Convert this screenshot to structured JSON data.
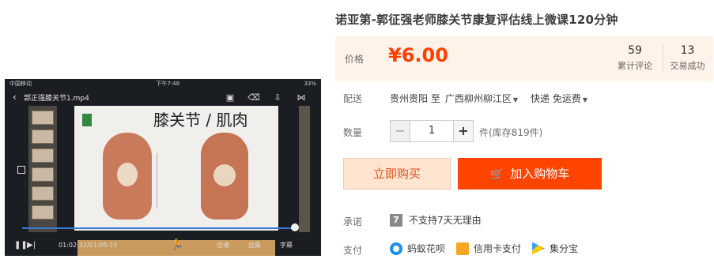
{
  "video": {
    "carrier": "中国移动",
    "time": "下午7:48",
    "battery": "33%",
    "filename": "郭正强膝关节1.mp4",
    "slide_title": "膝关节 / 肌肉",
    "current_time": "01:02:32",
    "total_time": "01:05:15",
    "speed_label": "倍速",
    "select_label": "选集",
    "subtitle_label": "字幕"
  },
  "product": {
    "title": "诺亚第-郭征强老师膝关节康复评估线上微课120分钟"
  },
  "price": {
    "label": "价格",
    "value": "¥6.00",
    "reviews_count": "59",
    "reviews_label": "累计评论",
    "deals_count": "13",
    "deals_label": "交易成功"
  },
  "shipping": {
    "label": "配送",
    "from": "贵州贵阳 至",
    "to": "广西柳州柳江区",
    "method": "快递 免运费"
  },
  "quantity": {
    "label": "数量",
    "value": "1",
    "minus": "−",
    "plus": "+",
    "stock": "件(库存819件)"
  },
  "actions": {
    "buy_now": "立即购买",
    "add_to_cart": "加入购物车"
  },
  "promise": {
    "label": "承诺",
    "badge": "7",
    "text": "不支持7天无理由"
  },
  "payment": {
    "label": "支付",
    "methods": [
      "蚂蚁花呗",
      "信用卡支付",
      "集分宝"
    ]
  },
  "colors": {
    "price": "#ff3f02",
    "cart_button": "#ff4400",
    "buy_button_bg": "#ffe4d0",
    "price_box_bg": "#fff2e8"
  }
}
